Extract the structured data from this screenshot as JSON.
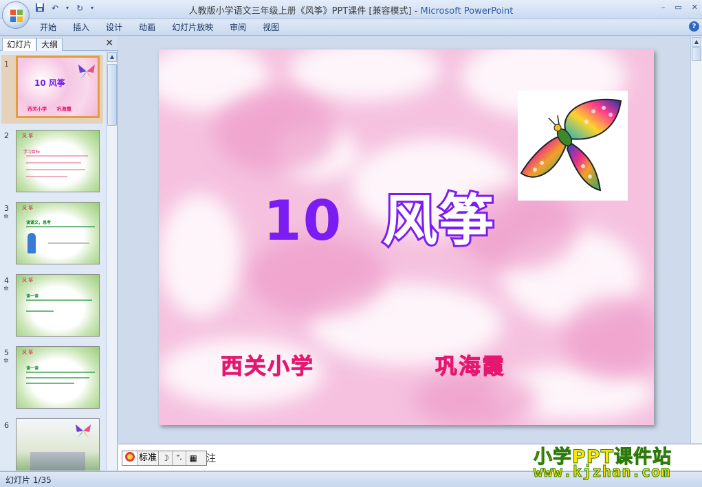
{
  "window": {
    "title_doc": "人教版小学语文三年级上册《风筝》PPT课件 [兼容模式]",
    "title_sep": " - ",
    "title_app": "Microsoft PowerPoint",
    "controls": {
      "minimize": "–",
      "restore": "▭",
      "close": "✕"
    }
  },
  "ribbon": {
    "tabs": [
      "开始",
      "插入",
      "设计",
      "动画",
      "幻灯片放映",
      "审阅",
      "视图"
    ],
    "help": "?"
  },
  "left_pane": {
    "tab_slides": "幻灯片",
    "tab_outline": "大纲",
    "close": "✕",
    "thumbnails": [
      {
        "num": "1",
        "title": "10  风筝",
        "line": "西关小学      巩海霞",
        "star": ""
      },
      {
        "num": "2",
        "title": "风  筝",
        "line": "学习目标",
        "star": ""
      },
      {
        "num": "3",
        "title": "风  筝",
        "line": "读课文，思考",
        "star": "✲"
      },
      {
        "num": "4",
        "title": "风  筝",
        "line": "读一读",
        "star": "✲"
      },
      {
        "num": "5",
        "title": "风  筝",
        "line": "读一读",
        "star": "✲"
      },
      {
        "num": "6",
        "title": "",
        "line": "",
        "star": ""
      }
    ]
  },
  "slide": {
    "number": "10",
    "title": "风筝",
    "school": "西关小学",
    "author": "巩海霞"
  },
  "notes": {
    "text": "注"
  },
  "ime": {
    "logo": "标准",
    "moon": "☽",
    "punct": "“,",
    "kbd": "▦"
  },
  "status": {
    "slide_info": "幻灯片 1/35"
  },
  "watermark": {
    "line1": "小学PPT课件站",
    "line2": "www.kjzhan.com"
  },
  "colors": {
    "accent": "#7a1cf2",
    "pink_text": "#e5176f",
    "selection": "#e69c3c"
  }
}
